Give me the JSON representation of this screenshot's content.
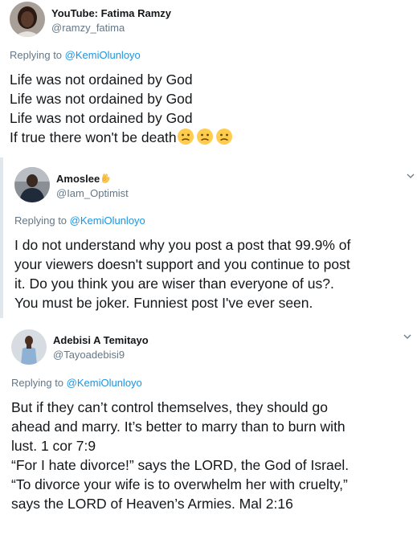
{
  "tweets": [
    {
      "display_name": "YouTube: Fatima Ramzy",
      "handle": "@ramzy_fatima",
      "replying_prefix": "Replying to ",
      "replying_to": "@KemiOlunloyo",
      "lines": [
        "Life was not ordained by God",
        "Life was not ordained by God",
        "Life was not ordained by God",
        "If true there won't be death"
      ],
      "trailing_emoji": "confused-face-emoji ×3"
    },
    {
      "display_name": "Amoslee",
      "name_emoji": "ok-hand-emoji",
      "handle": "@Iam_Optimist",
      "replying_prefix": "Replying to ",
      "replying_to": "@KemiOlunloyo",
      "lines": [
        "I do not understand why you post a post that 99.9% of",
        "your viewers doesn't support and you continue to post",
        "it.  Do you think you are wiser than everyone of us?.",
        "You must be joker. Funniest post I've ever seen."
      ]
    },
    {
      "display_name": "Adebisi A Temitayo",
      "handle": "@Tayoadebisi9",
      "replying_prefix": "Replying to ",
      "replying_to": "@KemiOlunloyo",
      "lines": [
        "But if they can’t control themselves, they should go",
        "ahead and marry. It’s better to marry than to burn with",
        "lust. 1 cor 7:9",
        "“For I hate divorce!” says the LORD, the God of Israel.",
        "“To divorce your wife is to overwhelm her with cruelty,”",
        "says the LORD of Heaven’s Armies. Mal 2:16"
      ]
    }
  ],
  "colors": {
    "link": "#1b95e0",
    "secondary_text": "#657786",
    "primary_text": "#14171a",
    "thread_bar": "#e1e8ed"
  }
}
